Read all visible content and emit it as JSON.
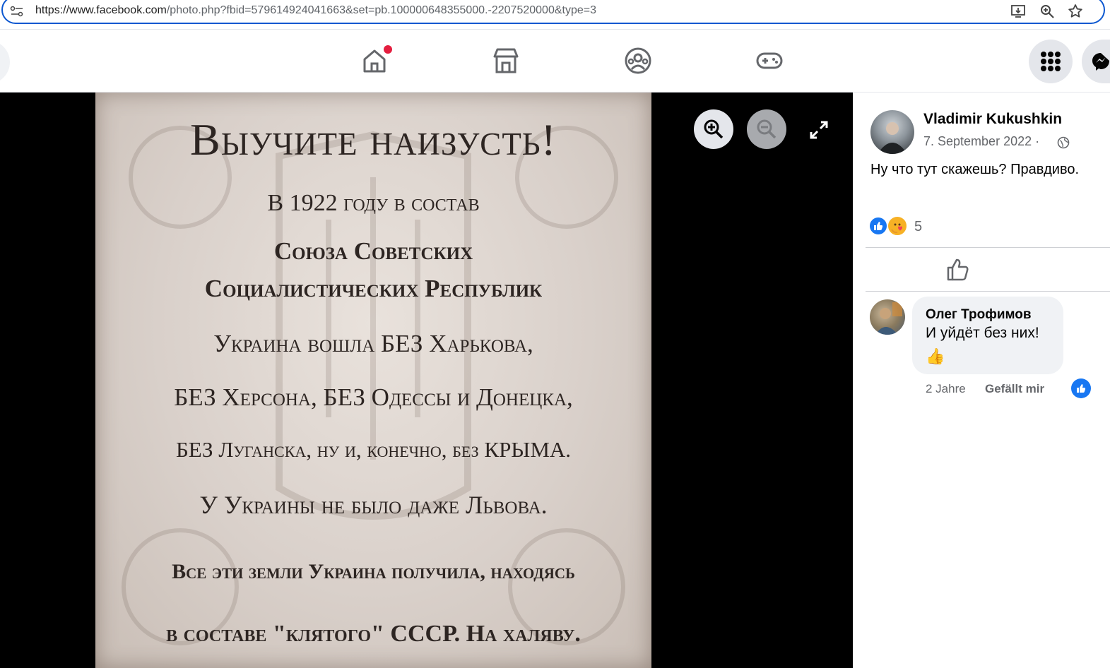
{
  "browser": {
    "url_prefix": "https://www.facebook.com",
    "url_rest": "/photo.php?fbid=579614924041663&set=pb.100000648355000.-2207520000&type=3",
    "icons": [
      "site-settings-icon",
      "install-icon",
      "zoom-icon",
      "bookmark-star-icon"
    ]
  },
  "nav": {
    "icons": [
      "home-icon",
      "marketplace-icon",
      "groups-icon",
      "gaming-icon",
      "menu-grid-icon",
      "messenger-icon"
    ],
    "notification_color": "#e41e3f"
  },
  "photo": {
    "lines": [
      "Выучите наизусть!",
      "В 1922 году в состав",
      "Союза Советских",
      "Социалистических Республик",
      "Украина вошла БЕЗ Харькова,",
      "БЕЗ Херсона, БЕЗ Одессы и Донецка,",
      "БЕЗ Луганска, ну и, конечно, без КРЫМА.",
      "У Украины не было даже Львова.",
      "Все эти земли Украина получила, находясь",
      "в составе \"клятого\" СССР. На халяву."
    ],
    "controls": [
      "zoom-in-icon",
      "zoom-out-icon",
      "fullscreen-icon"
    ]
  },
  "post": {
    "author": "Vladimir Kukushkin",
    "date": "7. September 2022 ·",
    "text": "Ну что тут скажешь? Правдиво.",
    "reaction_count": "5",
    "accent_color": "#1877f2"
  },
  "comment": {
    "author": "Олег Трофимов",
    "text": "И уйдёт без них!",
    "emoji": "👍",
    "time": "2 Jahre",
    "like_label": "Gefällt mir"
  }
}
